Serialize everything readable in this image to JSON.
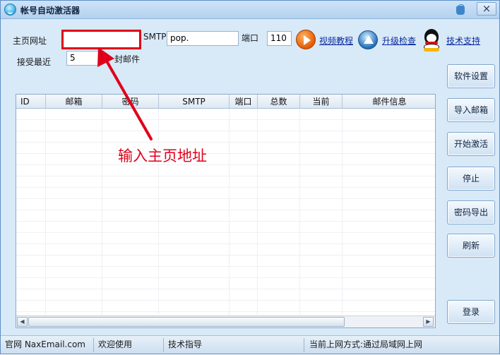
{
  "window": {
    "title": "帐号自动激活器",
    "close_label": "×"
  },
  "form": {
    "homepage_label": "主页网址",
    "homepage_value": "",
    "smtp_label": "SMTP",
    "smtp_value": "pop.",
    "port_label": "端口",
    "port_value": "110",
    "recent_label": "接受最近",
    "recent_value": "5",
    "recent_unit": "封邮件"
  },
  "links": {
    "video_tutorial": "视频教程",
    "update_check": "升级检查",
    "tech_support": "技术支持"
  },
  "table": {
    "columns": [
      "ID",
      "邮箱",
      "密码",
      "SMTP",
      "端口",
      "总数",
      "当前",
      "邮件信息"
    ],
    "rows": []
  },
  "side_buttons": {
    "settings": "软件设置",
    "import": "导入邮箱",
    "start": "开始激活",
    "stop": "停止",
    "export": "密码导出",
    "refresh": "刷新",
    "login": "登录"
  },
  "annotation": {
    "text": "输入主页地址",
    "color": "#e0001a"
  },
  "status": {
    "site": "官网 NaxEmail.com",
    "welcome": "欢迎使用",
    "guide": "技术指导",
    "network": "当前上网方式:通过局域网上网"
  },
  "scrollbar": {
    "left_arrow": "◀",
    "right_arrow": "▶"
  }
}
